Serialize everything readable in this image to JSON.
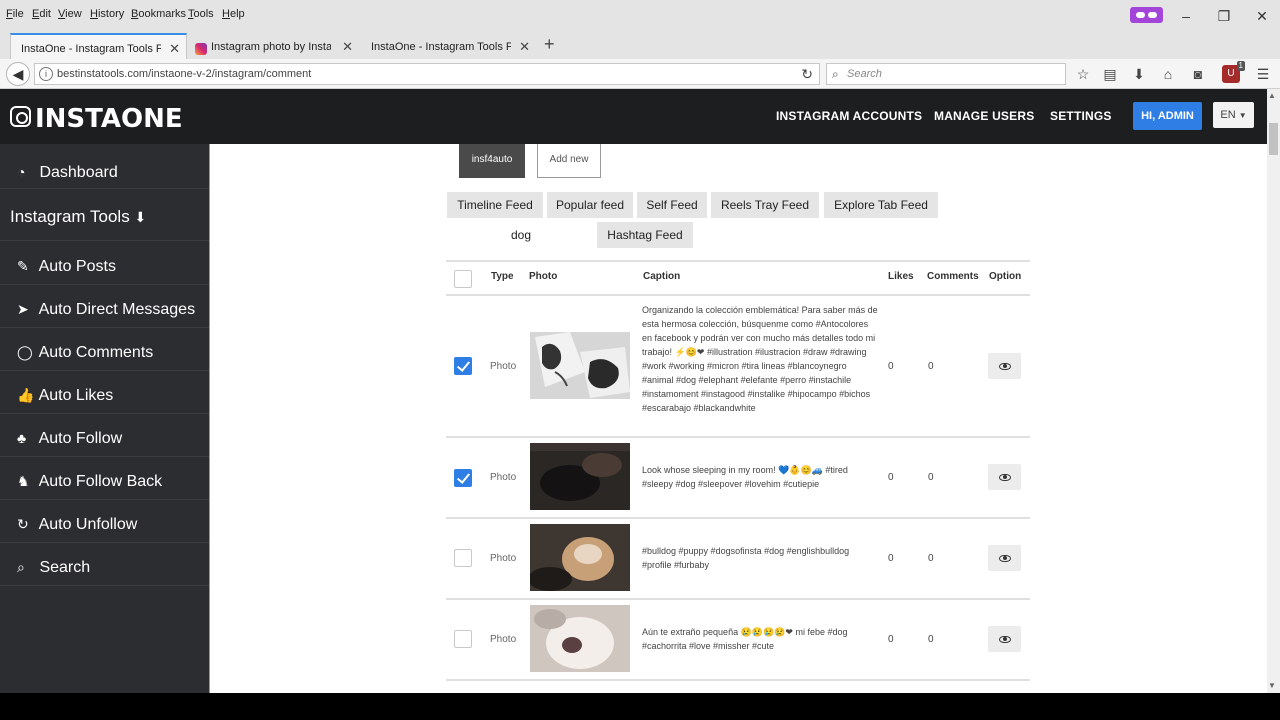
{
  "browser": {
    "menu": [
      "File",
      "Edit",
      "View",
      "History",
      "Bookmarks",
      "Tools",
      "Help"
    ],
    "tabs": [
      {
        "title": "InstaOne - Instagram Tools Fo..."
      },
      {
        "title": "Instagram photo by Insta..."
      },
      {
        "title": "InstaOne - Instagram Tools Fo..."
      }
    ],
    "new_tab": "+",
    "url": "bestinstatools.com/instaone-v-2/instagram/comment",
    "search_placeholder": "Search",
    "ublock_badge": "1"
  },
  "header": {
    "logo": "INSTAONE",
    "nav": [
      "INSTAGRAM ACCOUNTS",
      "MANAGE USERS",
      "SETTINGS"
    ],
    "user_button": "HI, ADMIN",
    "language": "EN"
  },
  "sidebar": {
    "items": [
      {
        "label": "Dashboard",
        "icon": "dashboard-icon"
      },
      {
        "label": "Instagram Tools",
        "icon": "chevron-circle-down-icon"
      },
      {
        "label": "Auto Posts",
        "icon": "edit-icon"
      },
      {
        "label": "Auto Direct Messages",
        "icon": "paper-plane-icon"
      },
      {
        "label": "Auto Comments",
        "icon": "comment-icon"
      },
      {
        "label": "Auto Likes",
        "icon": "thumbs-up-icon"
      },
      {
        "label": "Auto Follow",
        "icon": "user-plus-icon"
      },
      {
        "label": "Auto Follow Back",
        "icon": "user-follow-icon"
      },
      {
        "label": "Auto Unfollow",
        "icon": "refresh-icon"
      },
      {
        "label": "Search",
        "icon": "search-icon"
      }
    ]
  },
  "main": {
    "account_tab": "insf4auto",
    "add_new": "Add new",
    "feed_tabs": [
      "Timeline Feed",
      "Popular feed",
      "Self Feed",
      "Reels Tray Feed",
      "Explore Tab Feed"
    ],
    "hashtag_value": "dog",
    "hashtag_button": "Hashtag Feed",
    "columns": [
      "Type",
      "Photo",
      "Caption",
      "Likes",
      "Comments",
      "Option"
    ],
    "rows": [
      {
        "checked": true,
        "type": "Photo",
        "caption": "Organizando la colección emblemática! Para saber más de esta hermosa colección, búsquenme como #Antocolores en facebook y podrán ver con mucho más detalles todo mi trabajo! ⚡😊❤ #illustration #ilustracion #draw #drawing #work #working #micron #tira lineas #blancoynegro #animal #dog #elephant #elefante #perro #instachile #instamoment #instagood #instalike #hipocampo #bichos #escarabajo #blackandwhite",
        "likes": "0",
        "comments": "0"
      },
      {
        "checked": true,
        "type": "Photo",
        "caption": "Look whose sleeping in my room! 💙👶😊🚙 #tired #sleepy #dog #sleepover #lovehim #cutiepie",
        "likes": "0",
        "comments": "0"
      },
      {
        "checked": false,
        "type": "Photo",
        "caption": "#bulldog #puppy #dogsofinsta #dog #englishbulldog #profile #furbaby",
        "likes": "0",
        "comments": "0"
      },
      {
        "checked": false,
        "type": "Photo",
        "caption": "Aún te extraño pequeña 😢😢😢😢❤ mi febe #dog #cachorrita #love #missher #cute",
        "likes": "0",
        "comments": "0"
      }
    ]
  }
}
